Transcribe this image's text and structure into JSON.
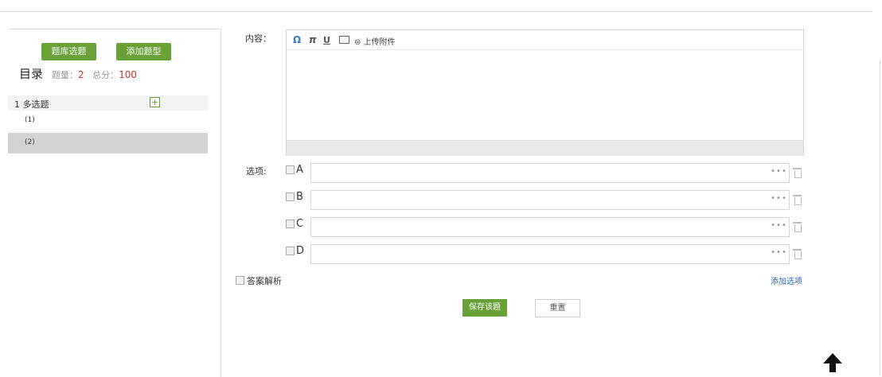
{
  "sidebar": {
    "bank_button": "题库选题",
    "add_type_button": "添加题型",
    "catalog_title": "目录",
    "count_label": "题量：",
    "count_value": "2",
    "score_label": "总分：",
    "score_value": "100",
    "section_label": "1 多选题",
    "add_question_icon": "plus-icon",
    "items": [
      {
        "label": "(1)"
      },
      {
        "label": "(2)",
        "selected": true
      }
    ]
  },
  "editor": {
    "content_label": "内容：",
    "toolbar": {
      "omega": "Ω",
      "pi": "π",
      "underline": "U",
      "image_icon": "image-icon",
      "upload_label": "⊜ 上传附件"
    }
  },
  "options": {
    "label": "选项:",
    "items": [
      {
        "letter": "A",
        "value": ""
      },
      {
        "letter": "B",
        "value": ""
      },
      {
        "letter": "C",
        "value": ""
      },
      {
        "letter": "D",
        "value": ""
      }
    ],
    "more": "•••",
    "trash_icon": "trash-icon"
  },
  "analysis_label": "答案解析",
  "add_option_label": "添加选项",
  "save_button": "保存该题",
  "reset_button": "重置",
  "scroll_top_icon": "arrow-up-icon",
  "colors": {
    "accent_green": "#6aa137",
    "link_blue": "#2b6cb0",
    "value_red": "#c0392b"
  }
}
